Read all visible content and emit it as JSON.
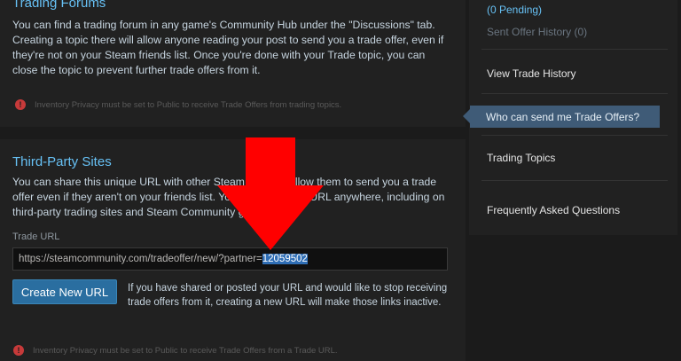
{
  "trading_forums": {
    "title": "Trading Forums",
    "body": "You can find a trading forum in any game's Community Hub under the \"Discussions\" tab. Creating a topic there will allow anyone reading your post to send you a trade offer, even if they're not on your Steam friends list. Once you're done with your Trade topic, you can close the topic to prevent further trade offers from it.",
    "note": "Inventory Privacy must be set to Public to receive Trade Offers from trading topics."
  },
  "third_party": {
    "title": "Third-Party Sites",
    "body": "You can share this unique URL with other Steam users to allow them to send you a trade offer even if they aren't on your friends list. You can share this URL anywhere, including on third-party trading sites and Steam Community groups.",
    "field_label": "Trade URL",
    "url_prefix": "https://steamcommunity.com/tradeoffer/new/?partner=",
    "url_partner": "12059502",
    "button_label": "Create New URL",
    "button_note": "If you have shared or posted your URL and would like to stop receiving trade offers from it, creating a new URL will make those links inactive.",
    "note": "Inventory Privacy must be set to Public to receive Trade Offers from a Trade URL."
  },
  "sidebar": {
    "pending": "(0 Pending)",
    "sent_history": "Sent Offer History (0)",
    "view_history": "View Trade History",
    "active": "Who can send me Trade Offers?",
    "trading_topics": "Trading Topics",
    "faq": "Frequently Asked Questions"
  },
  "colors": {
    "accent_blue": "#67c1f5",
    "annotation_red": "#ff0000",
    "warning_red": "#c73a3a"
  },
  "icons": {
    "warning": "warning-icon",
    "annotation": "red-arrow-annotation"
  }
}
